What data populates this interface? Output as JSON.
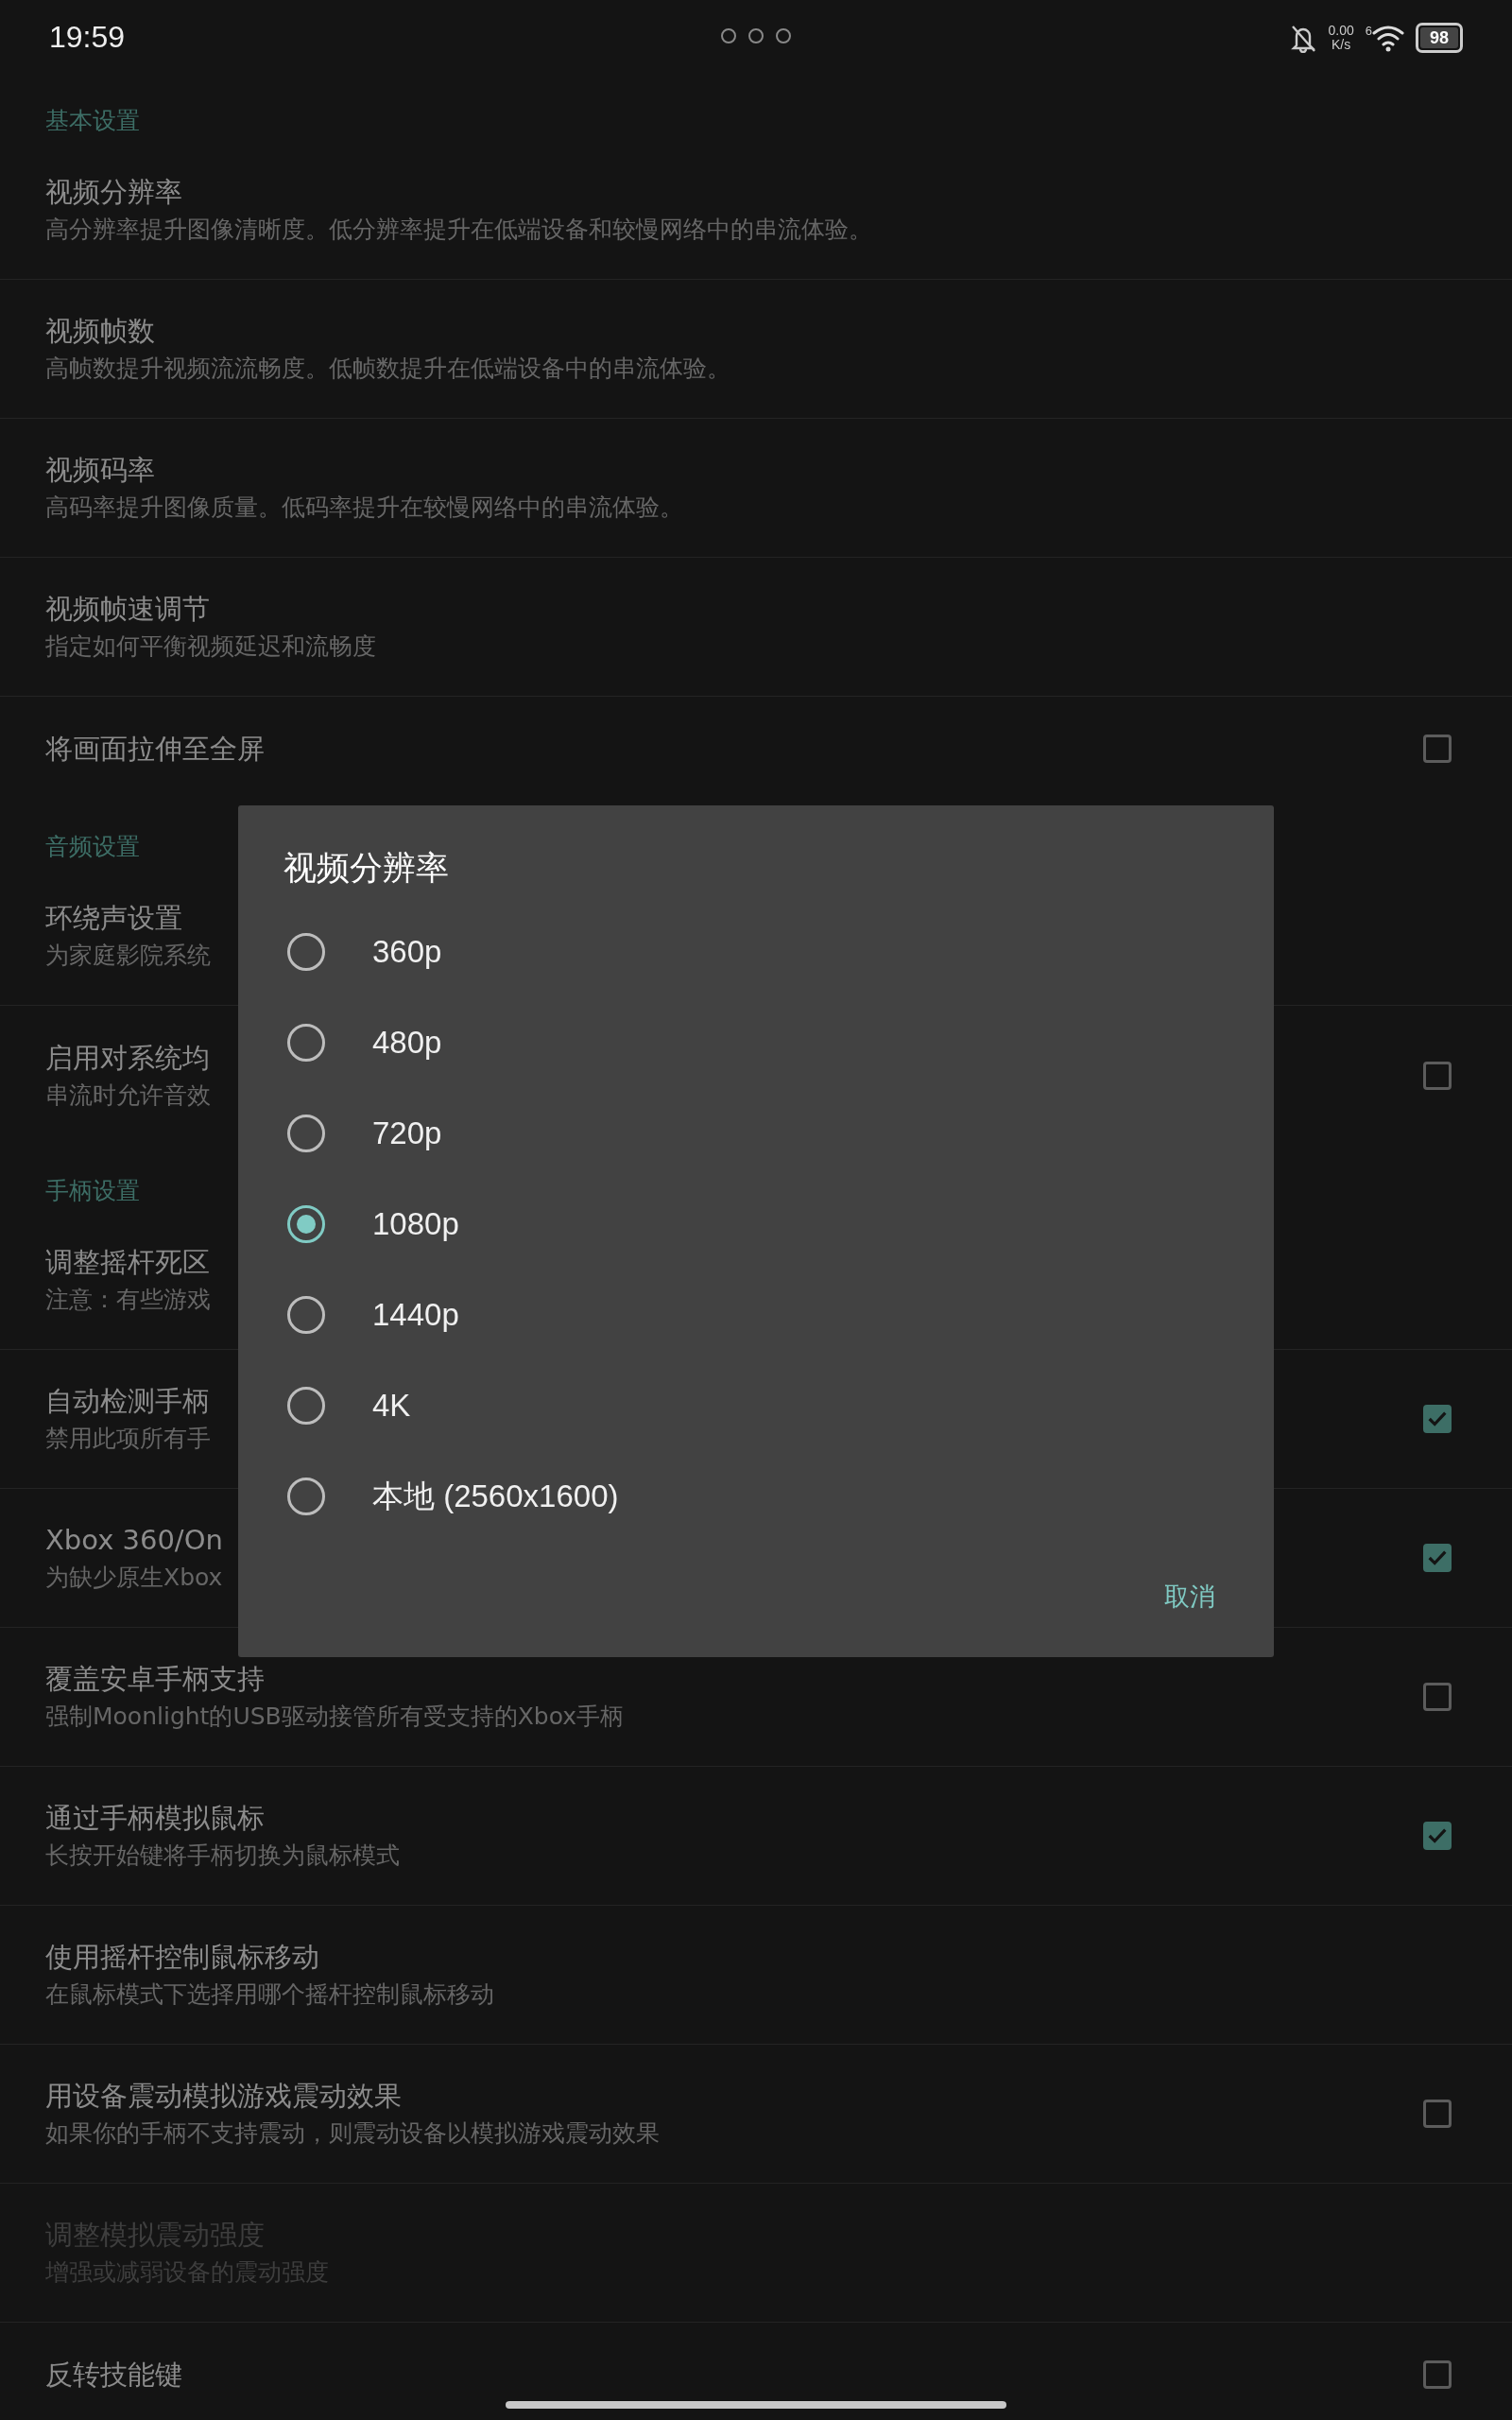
{
  "status_bar": {
    "time": "19:59",
    "net_speed": "0.00",
    "net_unit": "K/s",
    "wifi_badge": "6",
    "battery": "98"
  },
  "sections": [
    {
      "title": "基本设置",
      "items": [
        {
          "kind": "nav",
          "title": "视频分辨率",
          "subtitle": "高分辨率提升图像清晰度。低分辨率提升在低端设备和较慢网络中的串流体验。",
          "disabled": false
        },
        {
          "kind": "nav",
          "title": "视频帧数",
          "subtitle": "高帧数提升视频流流畅度。低帧数提升在低端设备中的串流体验。",
          "disabled": false
        },
        {
          "kind": "nav",
          "title": "视频码率",
          "subtitle": "高码率提升图像质量。低码率提升在较慢网络中的串流体验。",
          "disabled": false
        },
        {
          "kind": "nav",
          "title": "视频帧速调节",
          "subtitle": "指定如何平衡视频延迟和流畅度",
          "disabled": false
        },
        {
          "kind": "checkbox",
          "title": "将画面拉伸至全屏",
          "checked": false,
          "disabled": false
        }
      ]
    },
    {
      "title": "音频设置",
      "items": [
        {
          "kind": "nav",
          "title": "环绕声设置",
          "subtitle": "为家庭影院系统",
          "disabled": false
        },
        {
          "kind": "checkbox",
          "title": "启用对系统均",
          "subtitle": "串流时允许音效",
          "checked": false,
          "disabled": false
        }
      ]
    },
    {
      "title": "手柄设置",
      "items": [
        {
          "kind": "nav",
          "title": "调整摇杆死区",
          "subtitle": "注意：有些游戏",
          "disabled": false
        },
        {
          "kind": "checkbox",
          "title": "自动检测手柄",
          "subtitle": "禁用此项所有手",
          "checked": true,
          "disabled": false
        },
        {
          "kind": "checkbox",
          "title": "Xbox 360/On",
          "subtitle": "为缺少原生Xbox",
          "checked": true,
          "disabled": false
        },
        {
          "kind": "checkbox",
          "title": "覆盖安卓手柄支持",
          "subtitle": "强制Moonlight的USB驱动接管所有受支持的Xbox手柄",
          "checked": false,
          "disabled": false
        },
        {
          "kind": "checkbox",
          "title": "通过手柄模拟鼠标",
          "subtitle": "长按开始键将手柄切换为鼠标模式",
          "checked": true,
          "disabled": false
        },
        {
          "kind": "nav",
          "title": "使用摇杆控制鼠标移动",
          "subtitle": "在鼠标模式下选择用哪个摇杆控制鼠标移动",
          "disabled": false
        },
        {
          "kind": "checkbox",
          "title": "用设备震动模拟游戏震动效果",
          "subtitle": "如果你的手柄不支持震动，则震动设备以模拟游戏震动效果",
          "checked": false,
          "disabled": false
        },
        {
          "kind": "nav",
          "title": "调整模拟震动强度",
          "subtitle": "增强或减弱设备的震动强度",
          "disabled": true
        },
        {
          "kind": "checkbox",
          "title": "反转技能键",
          "checked": false,
          "disabled": false
        }
      ]
    }
  ],
  "dialog": {
    "title": "视频分辨率",
    "options": [
      {
        "label": "360p",
        "selected": false
      },
      {
        "label": "480p",
        "selected": false
      },
      {
        "label": "720p",
        "selected": false
      },
      {
        "label": "1080p",
        "selected": true
      },
      {
        "label": "1440p",
        "selected": false
      },
      {
        "label": "4K",
        "selected": false
      },
      {
        "label": "本地 (2560x1600)",
        "selected": false
      }
    ],
    "cancel": "取消"
  }
}
